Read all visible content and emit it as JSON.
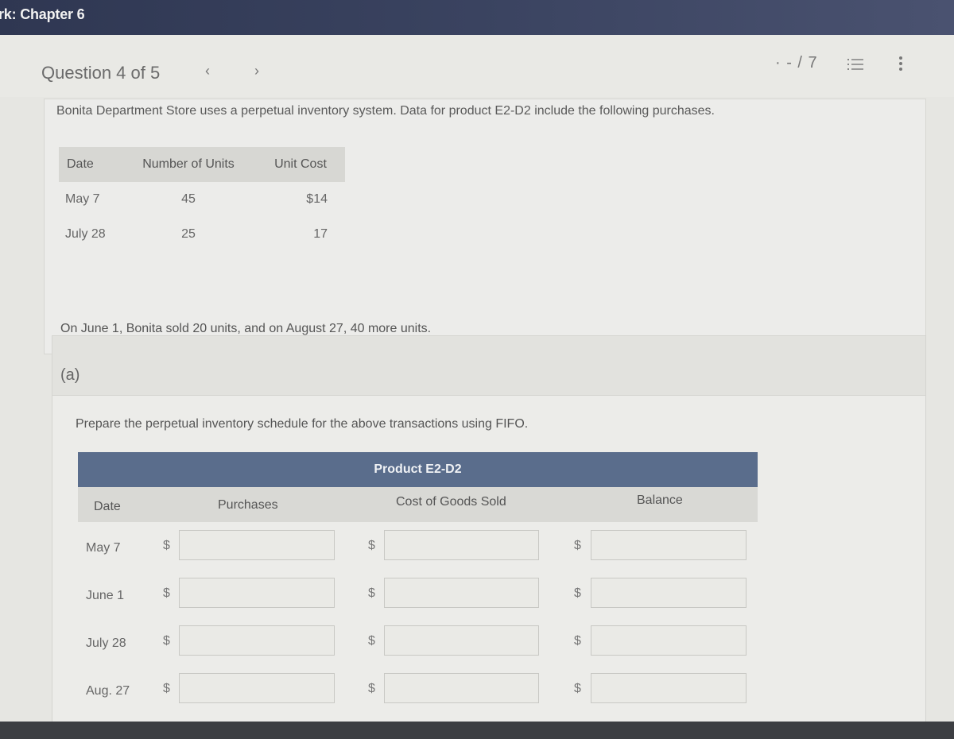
{
  "header": {
    "title": "rk: Chapter 6"
  },
  "question_nav": {
    "label": "Question 4 of 5",
    "prev_icon": "‹",
    "next_icon": "›",
    "score": "· - / 7",
    "list_icon": "numbered-list-icon",
    "more_icon": "more-vertical-icon"
  },
  "problem": {
    "intro": "Bonita Department Store uses a perpetual inventory system. Data for product E2-D2 include the following purchases.",
    "table": {
      "headers": [
        "Date",
        "Number of Units",
        "Unit Cost"
      ],
      "rows": [
        {
          "date": "May 7",
          "units": "45",
          "cost": "$14"
        },
        {
          "date": "July 28",
          "units": "25",
          "cost": "17"
        }
      ]
    },
    "sold_text": "On June 1, Bonita sold 20 units, and on August 27, 40 more units."
  },
  "part": {
    "label": "(a)",
    "instruction": "Prepare the perpetual inventory schedule for the above transactions using FIFO."
  },
  "schedule": {
    "title": "Product E2-D2",
    "columns": {
      "date": "Date",
      "purchases": "Purchases",
      "cogs": "Cost of Goods Sold",
      "balance": "Balance"
    },
    "currency": "$",
    "rows": [
      {
        "date": "May 7",
        "purchases": "",
        "cogs": "",
        "balance": ""
      },
      {
        "date": "June 1",
        "purchases": "",
        "cogs": "",
        "balance": ""
      },
      {
        "date": "July 28",
        "purchases": "",
        "cogs": "",
        "balance": ""
      },
      {
        "date": "Aug. 27",
        "purchases": "",
        "cogs": "",
        "balance": ""
      }
    ]
  }
}
